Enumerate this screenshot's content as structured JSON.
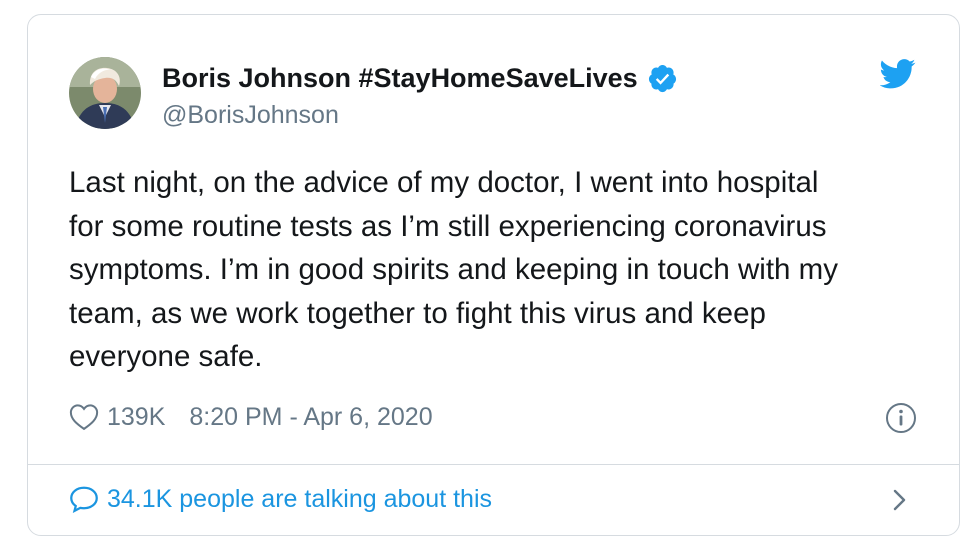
{
  "tweet": {
    "author_name": "Boris Johnson #StayHomeSaveLives",
    "handle": "@BorisJohnson",
    "text": "Last night, on the advice of my doctor, I went into hospital\nfor some routine tests as I’m still experiencing coronavirus\nsymptoms. I’m in good spirits and keeping in touch with my\nteam, as we work together to fight this virus and keep\neveryone safe.",
    "like_count": "139K",
    "timestamp": "8:20 PM - Apr 6, 2020",
    "talking_label": "34.1K people are talking about this"
  },
  "icons": {
    "verified": "verified-badge-icon",
    "twitter": "twitter-bird-icon",
    "like": "heart-icon",
    "info": "info-icon",
    "conversation": "speech-bubble-icon",
    "expand": "chevron-right-icon"
  },
  "colors": {
    "brand_blue": "#1da1f2",
    "link_blue": "#1b95e0",
    "text_primary": "#14171a",
    "text_secondary": "#657786",
    "border": "#d6dbe0"
  }
}
